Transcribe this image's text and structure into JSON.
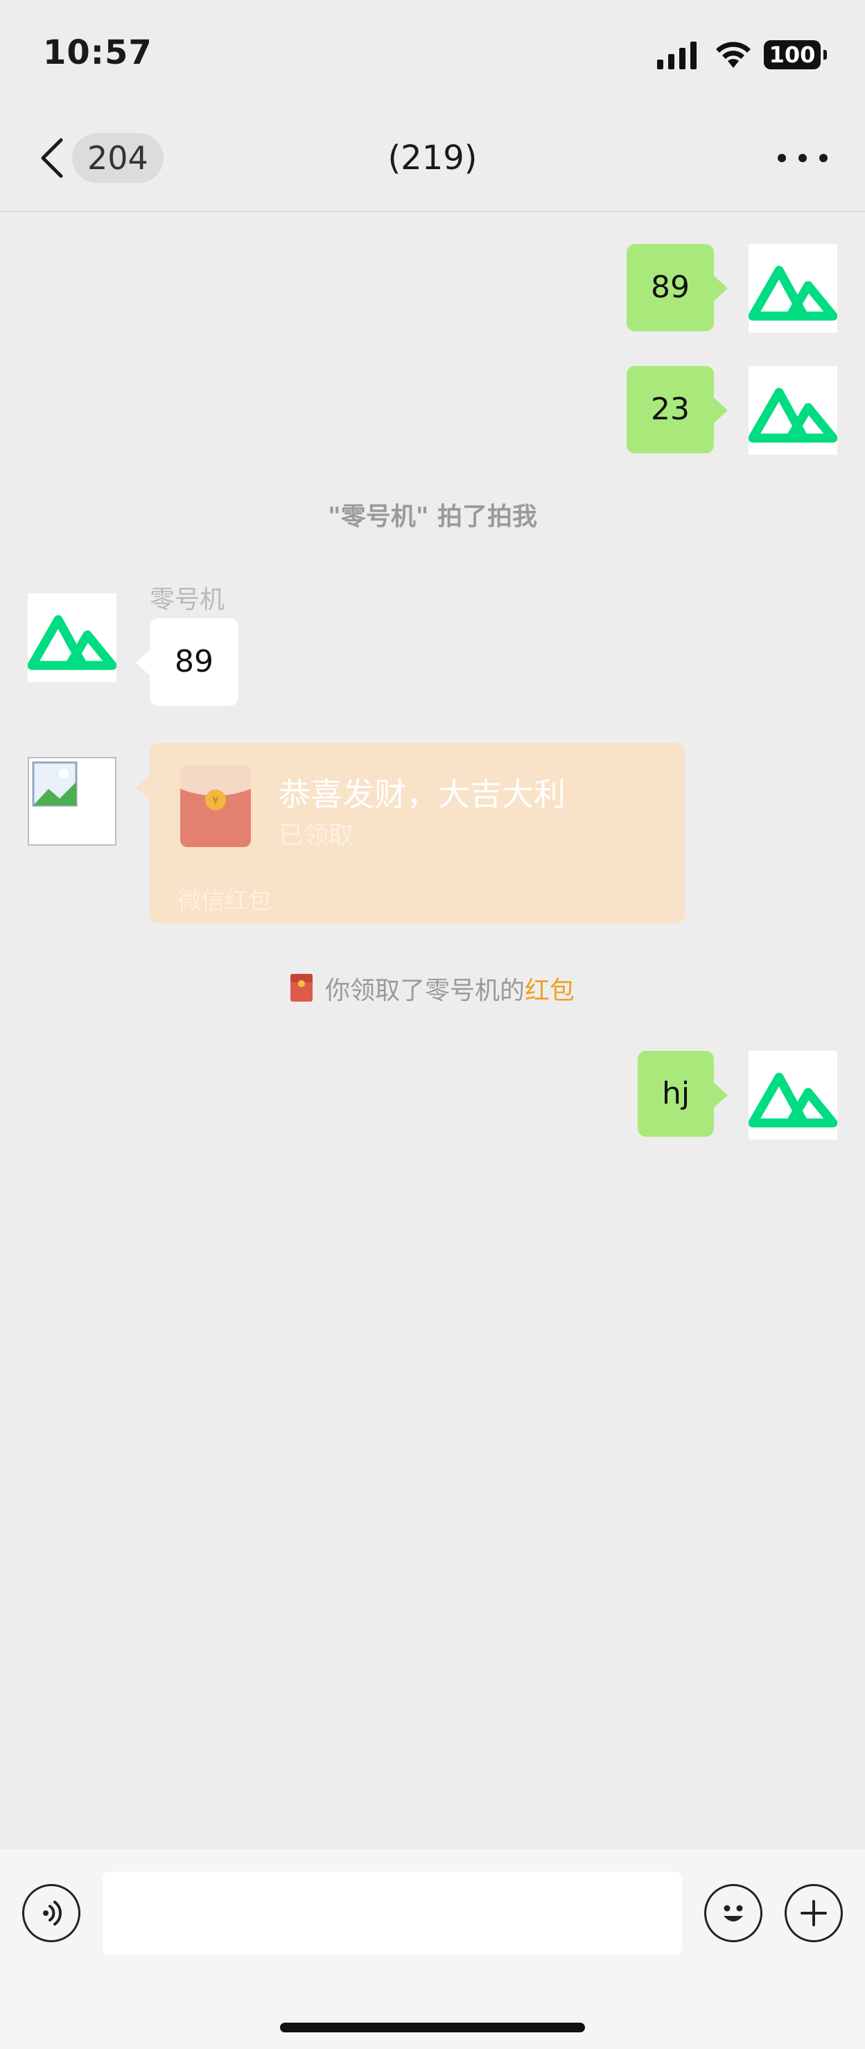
{
  "status_bar": {
    "time": "10:57",
    "battery": "100"
  },
  "nav": {
    "back_count": "204",
    "title": "(219)"
  },
  "messages": {
    "out_1": "89",
    "out_2": "23",
    "pat_notice": "\"零号机\" 拍了拍我",
    "sender_name": "零号机",
    "in_1": "89",
    "red_packet": {
      "greeting": "恭喜发财，大吉大利",
      "status": "已领取",
      "footer": "微信红包"
    },
    "received_notice_prefix": "你领取了零号机的",
    "received_notice_highlight": "红包",
    "out_3": "hj"
  },
  "input": {
    "placeholder": ""
  },
  "colors": {
    "outgoing_bubble": "#a9e97c",
    "avatar_logo": "#00dc82",
    "red_packet_bg": "#f8e2c8",
    "highlight": "#f0a020"
  },
  "icons": {
    "back": "chevron-left-icon",
    "more": "more-dots-icon",
    "voice": "voice-icon",
    "emoji": "emoji-icon",
    "add": "plus-icon",
    "avatar": "nuxt-logo-icon"
  }
}
